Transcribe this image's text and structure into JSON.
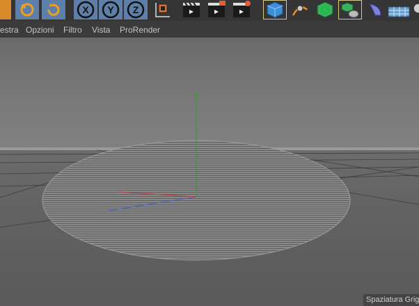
{
  "toolbar": {
    "buttons": [
      {
        "name": "scale-icon",
        "selected": false,
        "highlight": false
      },
      {
        "name": "rotate-icon",
        "selected": true,
        "highlight": false
      },
      {
        "name": "recent-tools-icon",
        "selected": true,
        "highlight": false
      },
      {
        "name": "x-axis-lock-icon",
        "label": "X",
        "selected": true
      },
      {
        "name": "y-axis-lock-icon",
        "label": "Y",
        "selected": true
      },
      {
        "name": "z-axis-lock-icon",
        "label": "Z",
        "selected": true
      },
      {
        "name": "coordinate-system-icon",
        "selected": false
      },
      {
        "name": "render-view-icon",
        "selected": false
      },
      {
        "name": "render-to-picture-viewer-icon",
        "selected": false
      },
      {
        "name": "render-settings-icon",
        "selected": false
      },
      {
        "name": "cube-icon",
        "selected": false,
        "highlight": true
      },
      {
        "name": "pen-spline-icon",
        "selected": false
      },
      {
        "name": "subdivision-surface-icon",
        "selected": false
      },
      {
        "name": "array-icon",
        "selected": false,
        "highlight": true
      },
      {
        "name": "deformer-icon",
        "selected": false
      },
      {
        "name": "floor-icon",
        "selected": false
      },
      {
        "name": "camera-icon",
        "selected": false
      }
    ]
  },
  "menu": {
    "items": [
      "estra",
      "Opzioni",
      "Filtro",
      "Vista",
      "ProRender"
    ]
  },
  "viewport": {
    "status_text": "Spaziatura Griglia",
    "colors": {
      "y_axis": "#3a9a3a",
      "x_axis": "#b84040",
      "z_axis": "#4a5fc8"
    }
  }
}
